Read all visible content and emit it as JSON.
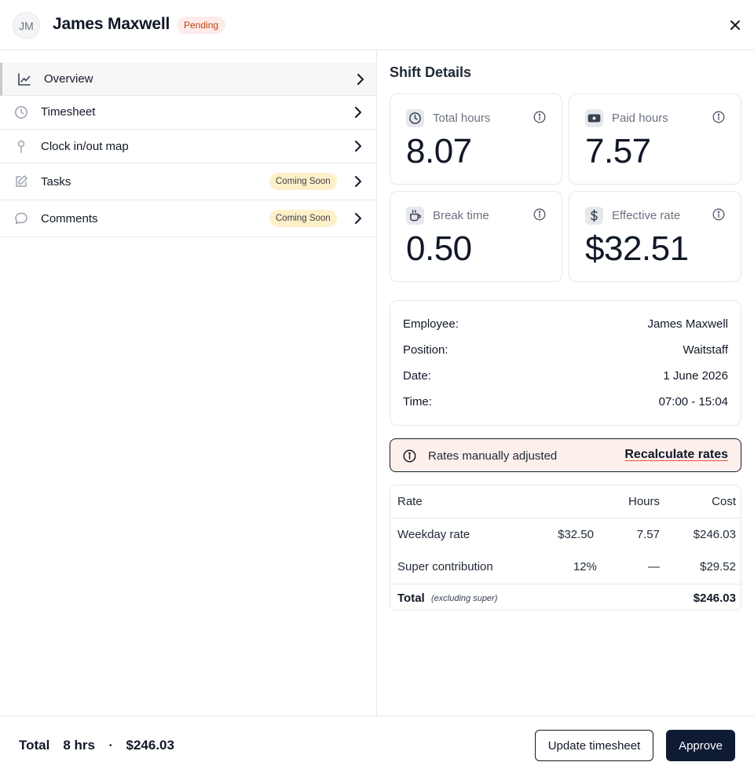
{
  "header": {
    "avatar_initials": "JM",
    "employee_name": "James Maxwell",
    "status_badge": "Pending"
  },
  "sidebar": {
    "items": [
      {
        "label": "Overview",
        "icon": "line-chart-icon",
        "active": true
      },
      {
        "label": "Timesheet",
        "icon": "clock-icon"
      },
      {
        "label": "Clock in/out map",
        "icon": "map-pin-icon"
      },
      {
        "label": "Tasks",
        "icon": "edit-icon",
        "badge": "Coming Soon"
      },
      {
        "label": "Comments",
        "icon": "chat-bubble-icon",
        "badge": "Coming Soon"
      }
    ]
  },
  "main": {
    "title": "Shift Details",
    "stats": [
      {
        "label": "Total hours",
        "value": "8.07",
        "icon": "clock-icon"
      },
      {
        "label": "Paid hours",
        "value": "7.57",
        "icon": "banknote-icon"
      },
      {
        "label": "Break time",
        "value": "0.50",
        "icon": "coffee-cup-icon"
      },
      {
        "label": "Effective rate",
        "value": "$32.51",
        "icon": "dollar-icon"
      }
    ],
    "details": [
      {
        "key": "Employee:",
        "value": "James Maxwell"
      },
      {
        "key": "Position:",
        "value": "Waitstaff"
      },
      {
        "key": "Date:",
        "value": "1 June 2026"
      },
      {
        "key": "Time:",
        "value": "07:00 - 15:04"
      }
    ],
    "alert": {
      "text": "Rates manually adjusted",
      "action": "Recalculate rates"
    },
    "rates": {
      "headers": {
        "rate": "Rate",
        "hours": "Hours",
        "cost": "Cost"
      },
      "rows": [
        {
          "name": "Weekday rate",
          "rate": "$32.50",
          "hours": "7.57",
          "cost": "$246.03"
        },
        {
          "name": "Super contribution",
          "rate": "12%",
          "hours": "—",
          "cost": "$29.52"
        }
      ],
      "total": {
        "label": "Total",
        "note": "(excluding super)",
        "cost": "$246.03"
      }
    }
  },
  "footer": {
    "total_label": "Total",
    "hours": "8 hrs",
    "separator": "•",
    "amount": "$246.03",
    "update_button": "Update timesheet",
    "approve_button": "Approve"
  },
  "colors": {
    "pending_bg": "#fdecea",
    "pending_text": "#c2410c",
    "coming_soon_bg": "#fdf0c8",
    "alert_bg": "#fdf0ec",
    "alert_link_underline": "#e5533b",
    "primary_button": "#0f1b33"
  }
}
